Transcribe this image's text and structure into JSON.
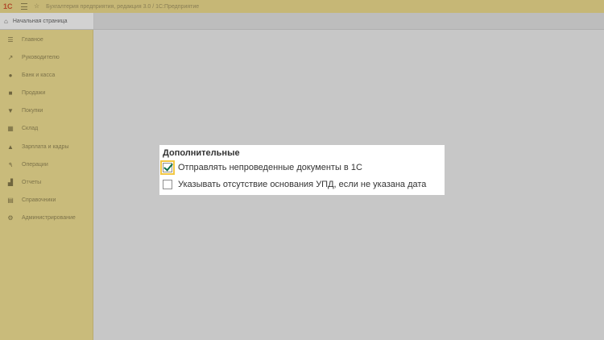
{
  "titlebar": {
    "logo_text": "1С",
    "title": "Бухгалтерия предприятия, редакция 3.0 / 1С:Предприятие"
  },
  "tabs": {
    "home_label": "Начальная страница"
  },
  "sidebar": {
    "items": [
      {
        "label": "Главное",
        "icon": "list-icon"
      },
      {
        "label": "Руководителю",
        "icon": "chart-icon"
      },
      {
        "label": "Банк и касса",
        "icon": "bank-icon"
      },
      {
        "label": "Продажи",
        "icon": "cart-icon"
      },
      {
        "label": "Покупки",
        "icon": "basket-icon"
      },
      {
        "label": "Склад",
        "icon": "warehouse-icon"
      },
      {
        "label": "Зарплата и кадры",
        "icon": "person-icon"
      },
      {
        "label": "Операции",
        "icon": "operations-icon"
      },
      {
        "label": "Отчеты",
        "icon": "reports-icon"
      },
      {
        "label": "Справочники",
        "icon": "book-icon"
      },
      {
        "label": "Администрирование",
        "icon": "gear-icon"
      }
    ]
  },
  "panel": {
    "title": "Дополнительные",
    "options": [
      {
        "label": "Отправлять непроведенные документы в 1С",
        "checked": true
      },
      {
        "label": "Указывать отсутствие основания УПД, если не указана дата",
        "checked": false
      }
    ]
  },
  "colors": {
    "sidebar_bg": "#c9bb7b",
    "titlebar_bg": "#c6b776",
    "workspace_bg": "#c7c7c7",
    "check_color": "#0f6e4b",
    "focus_color": "#f2c744"
  }
}
